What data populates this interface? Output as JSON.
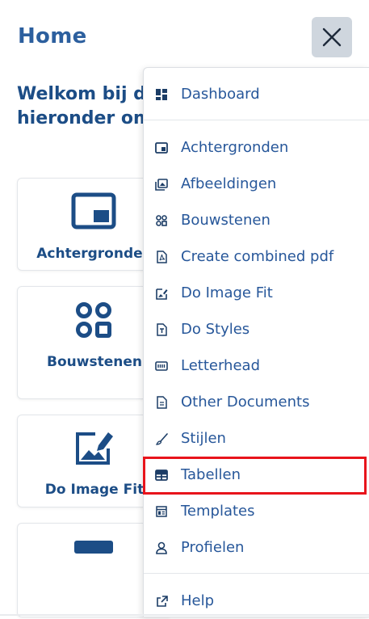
{
  "header": {
    "title": "Home"
  },
  "welcome": {
    "line1": "Welkom bij de",
    "line2": "hieronder om"
  },
  "cards": [
    {
      "label": "Achtergronden",
      "icon": "background-icon"
    },
    {
      "label": "Bouwstenen",
      "icon": "building-blocks-icon"
    },
    {
      "label": "Do Image Fit",
      "icon": "image-fit-icon"
    },
    {
      "label": "",
      "icon": "letterhead-icon"
    }
  ],
  "menu": {
    "items": [
      {
        "label": "Dashboard",
        "icon": "dashboard-icon"
      },
      {
        "label": "Achtergronden",
        "icon": "background-icon"
      },
      {
        "label": "Afbeeldingen",
        "icon": "images-icon"
      },
      {
        "label": "Bouwstenen",
        "icon": "building-blocks-icon"
      },
      {
        "label": "Create combined pdf",
        "icon": "pdf-icon"
      },
      {
        "label": "Do Image Fit",
        "icon": "image-fit-icon"
      },
      {
        "label": "Do Styles",
        "icon": "styles-icon"
      },
      {
        "label": "Letterhead",
        "icon": "letterhead-icon"
      },
      {
        "label": "Other Documents",
        "icon": "document-icon"
      },
      {
        "label": "Stijlen",
        "icon": "brush-icon"
      },
      {
        "label": "Tabellen",
        "icon": "table-icon"
      },
      {
        "label": "Templates",
        "icon": "templates-icon"
      },
      {
        "label": "Profielen",
        "icon": "user-icon"
      },
      {
        "label": "Help",
        "icon": "external-link-icon"
      }
    ],
    "highlighted": "Tabellen"
  },
  "colors": {
    "primary": "#2c5f9e",
    "dark": "#1c4d86",
    "highlight": "#e8141b"
  }
}
